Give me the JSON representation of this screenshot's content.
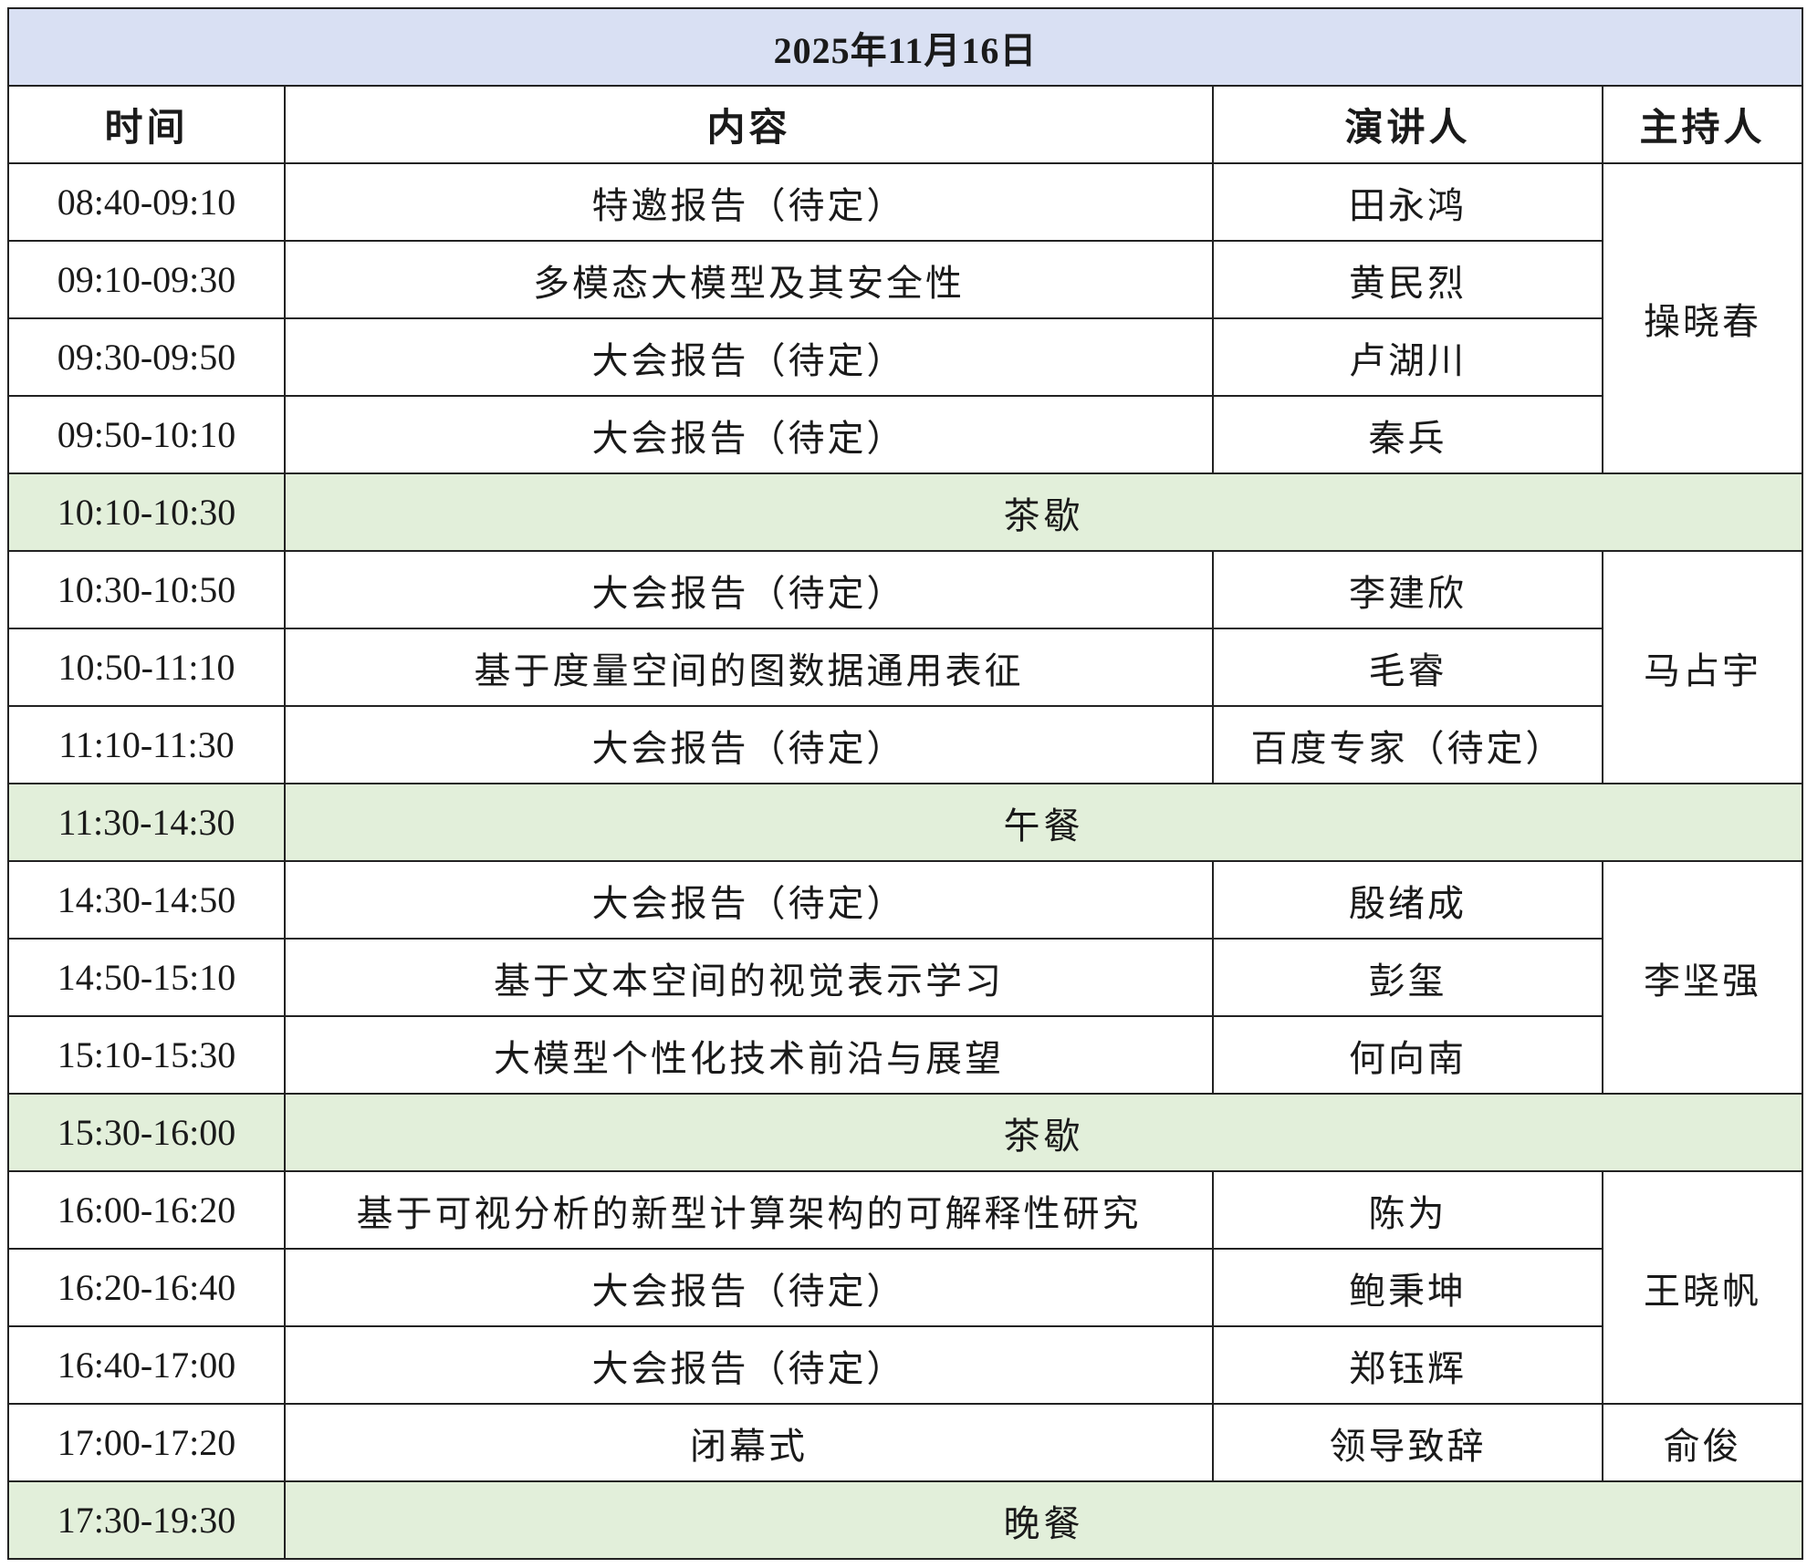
{
  "date": "2025年11月16日",
  "headers": {
    "time": "时间",
    "content": "内容",
    "speaker": "演讲人",
    "host": "主持人"
  },
  "rows": [
    {
      "time": "08:40-09:10",
      "content": "特邀报告（待定）",
      "speaker": "田永鸿"
    },
    {
      "time": "09:10-09:30",
      "content": "多模态大模型及其安全性",
      "speaker": "黄民烈"
    },
    {
      "time": "09:30-09:50",
      "content": "大会报告（待定）",
      "speaker": "卢湖川"
    },
    {
      "time": "09:50-10:10",
      "content": "大会报告（待定）",
      "speaker": "秦兵"
    },
    {
      "time": "10:10-10:30",
      "label": "茶歇"
    },
    {
      "time": "10:30-10:50",
      "content": "大会报告（待定）",
      "speaker": "李建欣"
    },
    {
      "time": "10:50-11:10",
      "content": "基于度量空间的图数据通用表征",
      "speaker": "毛睿"
    },
    {
      "time": "11:10-11:30",
      "content": "大会报告（待定）",
      "speaker": "百度专家（待定）"
    },
    {
      "time": "11:30-14:30",
      "label": "午餐"
    },
    {
      "time": "14:30-14:50",
      "content": "大会报告（待定）",
      "speaker": "殷绪成"
    },
    {
      "time": "14:50-15:10",
      "content": "基于文本空间的视觉表示学习",
      "speaker": "彭玺"
    },
    {
      "time": "15:10-15:30",
      "content": "大模型个性化技术前沿与展望",
      "speaker": "何向南"
    },
    {
      "time": "15:30-16:00",
      "label": "茶歇"
    },
    {
      "time": "16:00-16:20",
      "content": "基于可视分析的新型计算架构的可解释性研究",
      "speaker": "陈为"
    },
    {
      "time": "16:20-16:40",
      "content": "大会报告（待定）",
      "speaker": "鲍秉坤"
    },
    {
      "time": "16:40-17:00",
      "content": "大会报告（待定）",
      "speaker": "郑钰辉"
    },
    {
      "time": "17:00-17:20",
      "content": "闭幕式",
      "speaker": "领导致辞"
    },
    {
      "time": "17:30-19:30",
      "label": "晚餐"
    }
  ],
  "hosts": [
    "操晓春",
    "马占宇",
    "李坚强",
    "王晓帆",
    "俞俊"
  ],
  "colors": {
    "header_bg": "#d9e0f3",
    "break_bg": "#e2efda",
    "border": "#222222"
  }
}
